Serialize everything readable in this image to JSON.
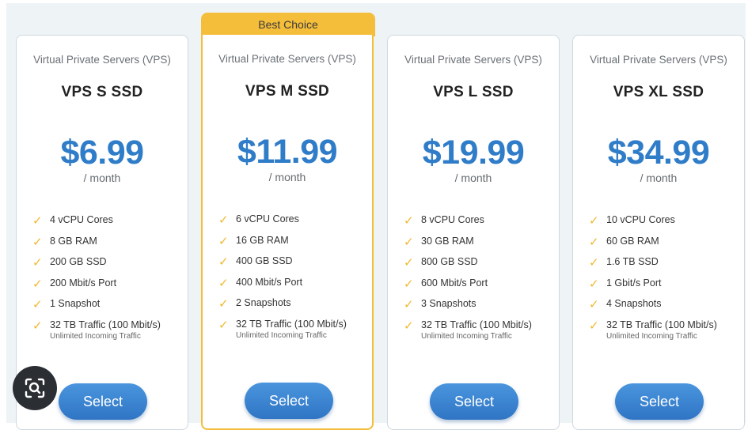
{
  "badge": {
    "label": "Best Choice"
  },
  "plans": [
    {
      "category": "Virtual Private Servers (VPS)",
      "name": "VPS S SSD",
      "price": "$6.99",
      "period": "/ month",
      "features": [
        "4 vCPU Cores",
        "8 GB RAM",
        "200 GB SSD",
        "200 Mbit/s Port",
        "1 Snapshot",
        "32 TB Traffic (100 Mbit/s)"
      ],
      "traffic_note": "Unlimited Incoming Traffic",
      "button": "Select"
    },
    {
      "category": "Virtual Private Servers (VPS)",
      "name": "VPS M SSD",
      "price": "$11.99",
      "period": "/ month",
      "features": [
        "6 vCPU Cores",
        "16 GB RAM",
        "400 GB SSD",
        "400 Mbit/s Port",
        "2 Snapshots",
        "32 TB Traffic (100 Mbit/s)"
      ],
      "traffic_note": "Unlimited Incoming Traffic",
      "button": "Select"
    },
    {
      "category": "Virtual Private Servers (VPS)",
      "name": "VPS L SSD",
      "price": "$19.99",
      "period": "/ month",
      "features": [
        "8 vCPU Cores",
        "30 GB RAM",
        "800 GB SSD",
        "600 Mbit/s Port",
        "3 Snapshots",
        "32 TB Traffic (100 Mbit/s)"
      ],
      "traffic_note": "Unlimited Incoming Traffic",
      "button": "Select"
    },
    {
      "category": "Virtual Private Servers (VPS)",
      "name": "VPS XL SSD",
      "price": "$34.99",
      "period": "/ month",
      "features": [
        "10 vCPU Cores",
        "60 GB RAM",
        "1.6 TB SSD",
        "1 Gbit/s Port",
        "4 Snapshots",
        "32 TB Traffic (100 Mbit/s)"
      ],
      "traffic_note": "Unlimited Incoming Traffic",
      "button": "Select"
    }
  ],
  "icons": {
    "check": "check-icon",
    "lens": "visual-search-icon"
  },
  "colors": {
    "accent": "#2f7cc8",
    "badge": "#f4bd3a",
    "check": "#f0b82e",
    "button": "#3a86d4"
  }
}
